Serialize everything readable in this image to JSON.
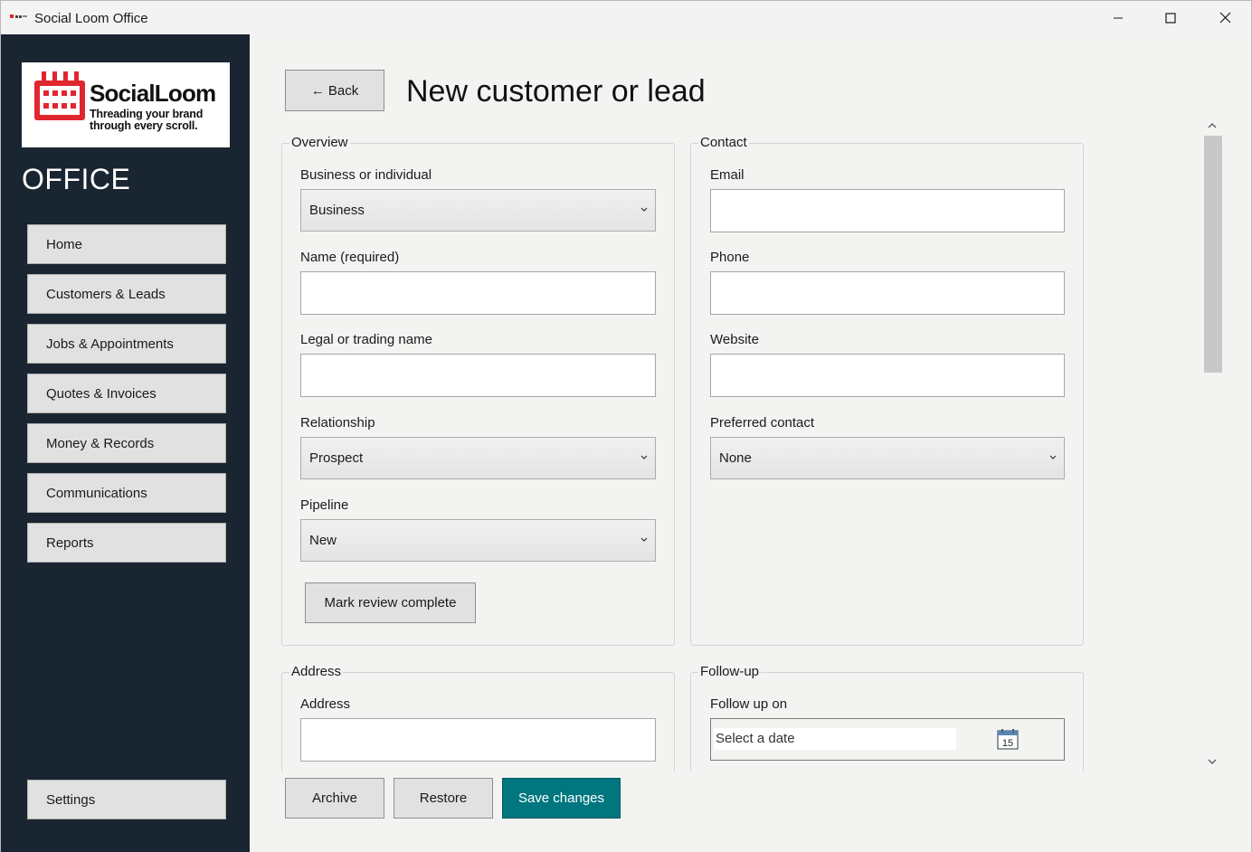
{
  "window": {
    "title": "Social Loom Office"
  },
  "sidebar": {
    "logo": {
      "brand": "SocialLoom",
      "tagline_1": "Threading your brand",
      "tagline_2": "through every scroll."
    },
    "section_title": "OFFICE",
    "items": [
      {
        "label": "Home"
      },
      {
        "label": "Customers & Leads"
      },
      {
        "label": "Jobs & Appointments"
      },
      {
        "label": "Quotes & Invoices"
      },
      {
        "label": "Money & Records"
      },
      {
        "label": "Communications"
      },
      {
        "label": "Reports"
      }
    ],
    "settings_label": "Settings"
  },
  "header": {
    "back_label": "← Back",
    "title": "New customer or lead"
  },
  "overview": {
    "legend": "Overview",
    "business_label": "Business or individual",
    "business_value": "Business",
    "name_label": "Name (required)",
    "name_value": "",
    "legal_label": "Legal or trading name",
    "legal_value": "",
    "relationship_label": "Relationship",
    "relationship_value": "Prospect",
    "pipeline_label": "Pipeline",
    "pipeline_value": "New",
    "review_button": "Mark review complete"
  },
  "contact": {
    "legend": "Contact",
    "email_label": "Email",
    "email_value": "",
    "phone_label": "Phone",
    "phone_value": "",
    "website_label": "Website",
    "website_value": "",
    "preferred_label": "Preferred contact",
    "preferred_value": "None"
  },
  "address": {
    "legend": "Address",
    "address_label": "Address",
    "address_value": ""
  },
  "followup": {
    "legend": "Follow-up",
    "date_label": "Follow up on",
    "date_placeholder": "Select a date",
    "calendar_day": "15"
  },
  "footer": {
    "archive_label": "Archive",
    "restore_label": "Restore",
    "save_label": "Save changes"
  },
  "colors": {
    "sidebar_bg": "#192530",
    "accent": "#00767f",
    "logo_red": "#e0262f"
  }
}
